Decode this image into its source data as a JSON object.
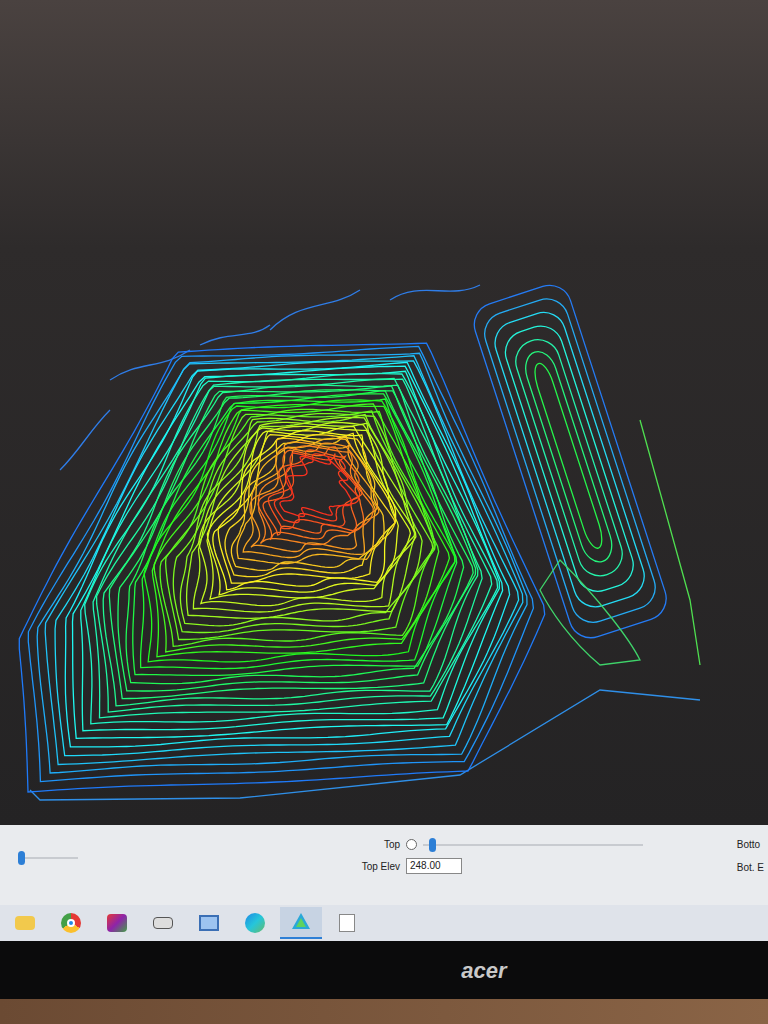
{
  "map_panel": {
    "top_label": "Top",
    "top_elev_label": "Top Elev",
    "top_elev_value": "248.00",
    "bottom_label": "Botto",
    "bot_elev_label": "Bot. E",
    "left_slider": {
      "level": 0.0
    },
    "top_slider": {
      "level": 0.03
    },
    "top_radio": {
      "selected": false
    }
  },
  "taskbar": {
    "apps": [
      {
        "kind": "folder",
        "selected": false
      },
      {
        "kind": "chrome",
        "selected": false
      },
      {
        "kind": "gallery",
        "selected": false
      },
      {
        "kind": "printer",
        "selected": false
      },
      {
        "kind": "computer",
        "selected": false
      },
      {
        "kind": "edge",
        "selected": false
      },
      {
        "kind": "surveyor",
        "selected": true
      },
      {
        "kind": "notepad",
        "selected": false
      }
    ]
  },
  "monitor": {
    "brand": "acer"
  }
}
